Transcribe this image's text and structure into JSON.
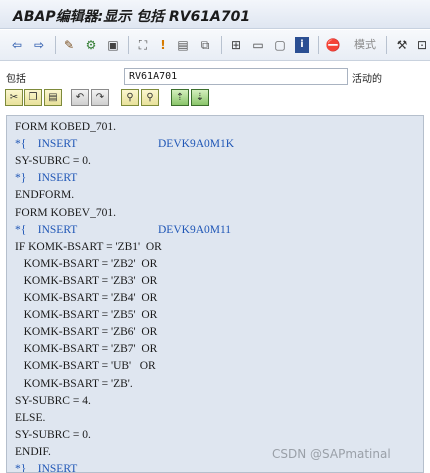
{
  "window": {
    "title": "ABAP编辑器:显示 包括 RV61A701"
  },
  "toolbar": {
    "icons": [
      "back-icon",
      "forward-icon",
      "edit-icon",
      "toggle-icon",
      "other-object-icon",
      "check-icon",
      "flag-icon",
      "bookmark-icon",
      "where-used-icon",
      "network-icon",
      "insert-icon",
      "display-icon",
      "info-icon",
      "stop-icon",
      "settings-icon"
    ],
    "pattern_label": "模式"
  },
  "field": {
    "label": "包括",
    "value": "RV61A701",
    "status": "活动的"
  },
  "code_lines": [
    {
      "text": "FORM KOBED_701.",
      "kind": "code"
    },
    {
      "text": "*{    INSERT",
      "ref": "DEVK9A0M1K",
      "kind": "comment"
    },
    {
      "text": "SY-SUBRC = 0.",
      "kind": "code"
    },
    {
      "text": "*}    INSERT",
      "kind": "comment"
    },
    {
      "text": "ENDFORM.",
      "kind": "code"
    },
    {
      "text": "FORM KOBEV_701.",
      "kind": "code"
    },
    {
      "text": "*{    INSERT",
      "ref": "DEVK9A0M11",
      "kind": "comment"
    },
    {
      "text": "IF KOMK-BSART = 'ZB1'  OR",
      "kind": "code"
    },
    {
      "text": "   KOMK-BSART = 'ZB2'  OR",
      "kind": "code"
    },
    {
      "text": "   KOMK-BSART = 'ZB3'  OR",
      "kind": "code"
    },
    {
      "text": "   KOMK-BSART = 'ZB4'  OR",
      "kind": "code"
    },
    {
      "text": "   KOMK-BSART = 'ZB5'  OR",
      "kind": "code"
    },
    {
      "text": "   KOMK-BSART = 'ZB6'  OR",
      "kind": "code"
    },
    {
      "text": "   KOMK-BSART = 'ZB7'  OR",
      "kind": "code"
    },
    {
      "text": "   KOMK-BSART = 'UB'   OR",
      "kind": "code"
    },
    {
      "text": "   KOMK-BSART = 'ZB'.",
      "kind": "code"
    },
    {
      "text": "SY-SUBRC = 4.",
      "kind": "code"
    },
    {
      "text": "ELSE.",
      "kind": "code"
    },
    {
      "text": "SY-SUBRC = 0.",
      "kind": "code"
    },
    {
      "text": "ENDIF.",
      "kind": "code"
    },
    {
      "text": "*}    INSERT",
      "kind": "comment"
    }
  ],
  "watermark": "CSDN @SAPmatinal"
}
